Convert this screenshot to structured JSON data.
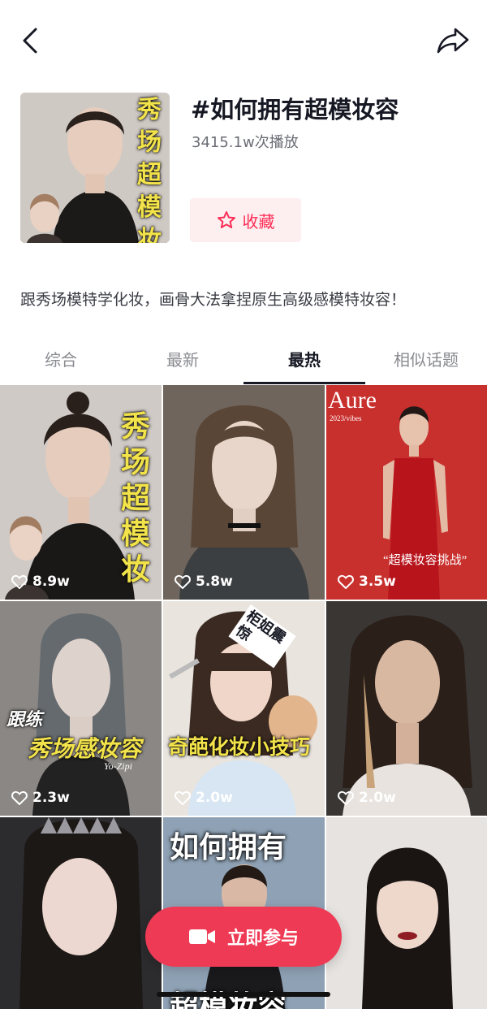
{
  "header": {
    "title": "#如何拥有超模妆容",
    "plays": "3415.1w次播放",
    "favorite_label": "收藏",
    "description": "跟秀场模特学化妆，画骨大法拿捏原生高级感模特妆容！",
    "hero_overlay": "秀场超模妆"
  },
  "tabs": [
    {
      "label": "综合",
      "active": false
    },
    {
      "label": "最新",
      "active": false
    },
    {
      "label": "最热",
      "active": true
    },
    {
      "label": "相似话题",
      "active": false
    }
  ],
  "videos": [
    {
      "likes": "8.9w",
      "overlay": "秀场超模妆"
    },
    {
      "likes": "5.8w",
      "overlay": ""
    },
    {
      "likes": "3.5w",
      "overlay": "“超模妆容挑战”",
      "brand": "Aure",
      "brand_sub": "2023/vibes"
    },
    {
      "likes": "2.3w",
      "overlay_1": "跟练",
      "overlay_2": "秀场感妆容",
      "signature": "Yo-Zipi"
    },
    {
      "likes": "2.0w",
      "overlay": "奇葩化妆小技巧",
      "side_text": "柜姐震惊"
    },
    {
      "likes": "2.0w",
      "overlay": ""
    },
    {
      "likes": "",
      "overlay": ""
    },
    {
      "likes": "",
      "overlay_top": "如何拥有",
      "overlay_bottom": "超模妆容"
    },
    {
      "likes": "",
      "overlay": ""
    }
  ],
  "join_button": {
    "label": "立即参与"
  },
  "colors": {
    "accent": "#fe2c55",
    "join_bg": "#ee3a55",
    "fav_bg": "#fdeef0"
  }
}
